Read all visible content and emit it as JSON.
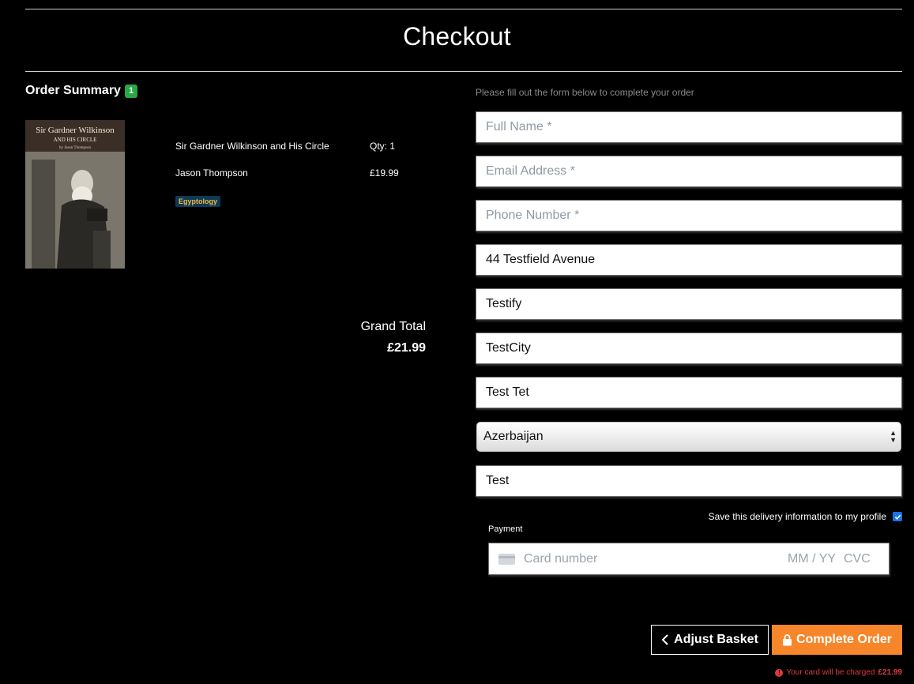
{
  "page": {
    "title": "Checkout"
  },
  "summary": {
    "heading": "Order Summary",
    "count": "1",
    "item": {
      "cover_title_line1": "Sir Gardner Wilkinson",
      "cover_title_line2": "AND HIS CIRCLE",
      "cover_author": "by Jason Thompson",
      "title": "Sir Gardner Wilkinson and His Circle",
      "author": "Jason Thompson",
      "qty": "Qty: 1",
      "price": "£19.99",
      "category": "Egyptology"
    },
    "grand_total_label": "Grand Total",
    "grand_total_value": "£21.99"
  },
  "form": {
    "hint": "Please fill out the form below to complete your order",
    "full_name": {
      "placeholder": "Full Name *",
      "value": ""
    },
    "email": {
      "placeholder": "Email Address *",
      "value": ""
    },
    "phone": {
      "placeholder": "Phone Number *",
      "value": ""
    },
    "street": {
      "value": "44 Testfield Avenue"
    },
    "town": {
      "value": "Testify"
    },
    "city": {
      "value": "TestCity"
    },
    "postcode": {
      "value": "Test Tet"
    },
    "country": {
      "value": "Azerbaijan"
    },
    "county": {
      "value": "Test"
    },
    "save_label": "Save this delivery information to my profile",
    "save_checked": true
  },
  "payment": {
    "label": "Payment",
    "card_placeholder": "Card number",
    "exp_placeholder": "MM / YY",
    "cvc_placeholder": "CVC"
  },
  "actions": {
    "adjust_label": "Adjust Basket",
    "complete_label": "Complete Order",
    "charge_note": "Your card will be charged",
    "charge_amount": "£21.99"
  },
  "colors": {
    "accent_orange": "#f7862a",
    "badge_green": "#28a745",
    "warning_red": "#e03a3a",
    "checkbox_blue": "#1a73e8"
  },
  "icons": {
    "back": "chevron-left-icon",
    "lock": "lock-icon",
    "warning": "exclamation-circle-icon",
    "card": "credit-card-icon",
    "select": "select-arrows-icon"
  }
}
